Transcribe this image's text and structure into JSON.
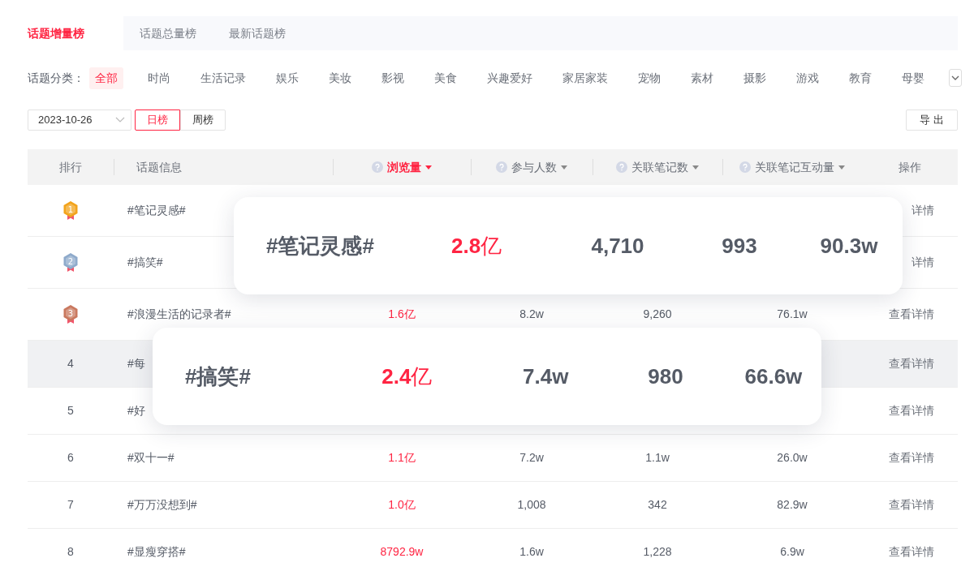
{
  "tabs": [
    {
      "label": "话题增量榜",
      "selected": true
    },
    {
      "label": "话题总量榜",
      "selected": false
    },
    {
      "label": "最新话题榜",
      "selected": false
    }
  ],
  "category_filter": {
    "label": "话题分类：",
    "items": [
      {
        "label": "全部",
        "selected": true
      },
      {
        "label": "时尚",
        "selected": false
      },
      {
        "label": "生活记录",
        "selected": false
      },
      {
        "label": "娱乐",
        "selected": false
      },
      {
        "label": "美妆",
        "selected": false
      },
      {
        "label": "影视",
        "selected": false
      },
      {
        "label": "美食",
        "selected": false
      },
      {
        "label": "兴趣爱好",
        "selected": false
      },
      {
        "label": "家居家装",
        "selected": false
      },
      {
        "label": "宠物",
        "selected": false
      },
      {
        "label": "素材",
        "selected": false
      },
      {
        "label": "摄影",
        "selected": false
      },
      {
        "label": "游戏",
        "selected": false
      },
      {
        "label": "教育",
        "selected": false
      },
      {
        "label": "母婴",
        "selected": false
      }
    ]
  },
  "date_picker": {
    "value": "2023-10-26"
  },
  "period_toggle": [
    {
      "label": "日榜",
      "selected": true
    },
    {
      "label": "周榜",
      "selected": false
    }
  ],
  "export_button": "导 出",
  "table": {
    "columns": [
      {
        "label": "排行",
        "help": false,
        "sortable": false,
        "selected": false
      },
      {
        "label": "话题信息",
        "help": false,
        "sortable": false,
        "selected": false
      },
      {
        "label": "浏览量",
        "help": true,
        "sortable": true,
        "selected": true
      },
      {
        "label": "参与人数",
        "help": true,
        "sortable": true,
        "selected": false
      },
      {
        "label": "关联笔记数",
        "help": true,
        "sortable": true,
        "selected": false
      },
      {
        "label": "关联笔记互动量",
        "help": true,
        "sortable": true,
        "selected": false
      },
      {
        "label": "操作",
        "help": false,
        "sortable": false,
        "selected": false
      }
    ],
    "rows": [
      {
        "kind": "medal",
        "rank": "1",
        "color": "#f2a31b",
        "highlighted": false,
        "topic": "#笔记灵感#",
        "action": "详情"
      },
      {
        "kind": "medal",
        "rank": "2",
        "color": "#8eaacb",
        "highlighted": false,
        "topic": "#搞笑#",
        "action": "详情"
      },
      {
        "kind": "medal",
        "rank": "3",
        "color": "#c9785e",
        "highlighted": false,
        "topic": "#浪漫生活的记录者#",
        "views": "1.6亿",
        "participants": "8.2w",
        "notes": "9,260",
        "interactions": "76.1w",
        "action": "查看详情"
      },
      {
        "kind": "number",
        "rank": "4",
        "highlighted": true,
        "topic": "#每",
        "action": "查看详情"
      },
      {
        "kind": "number",
        "rank": "5",
        "highlighted": false,
        "topic": "#好",
        "action": "查看详情"
      },
      {
        "kind": "number",
        "rank": "6",
        "highlighted": false,
        "topic": "#双十一#",
        "views": "1.1亿",
        "participants": "7.2w",
        "notes": "1.1w",
        "interactions": "26.0w",
        "action": "查看详情"
      },
      {
        "kind": "number",
        "rank": "7",
        "highlighted": false,
        "topic": "#万万没想到#",
        "views": "1.0亿",
        "participants": "1,008",
        "notes": "342",
        "interactions": "82.9w",
        "action": "查看详情"
      },
      {
        "kind": "number",
        "rank": "8",
        "highlighted": false,
        "topic": "#显瘦穿搭#",
        "views": "8792.9w",
        "participants": "1.6w",
        "notes": "1,228",
        "interactions": "6.9w",
        "action": "查看详情"
      }
    ]
  },
  "popups": [
    {
      "topic": "#笔记灵感#",
      "views": "**2.8**亿",
      "participants": "4,710",
      "notes": "993",
      "interactions": "90.3w"
    },
    {
      "topic": "#搞笑#",
      "views": "**2.4**亿",
      "participants": "7.4w",
      "notes": "980",
      "interactions": "66.6w"
    }
  ]
}
